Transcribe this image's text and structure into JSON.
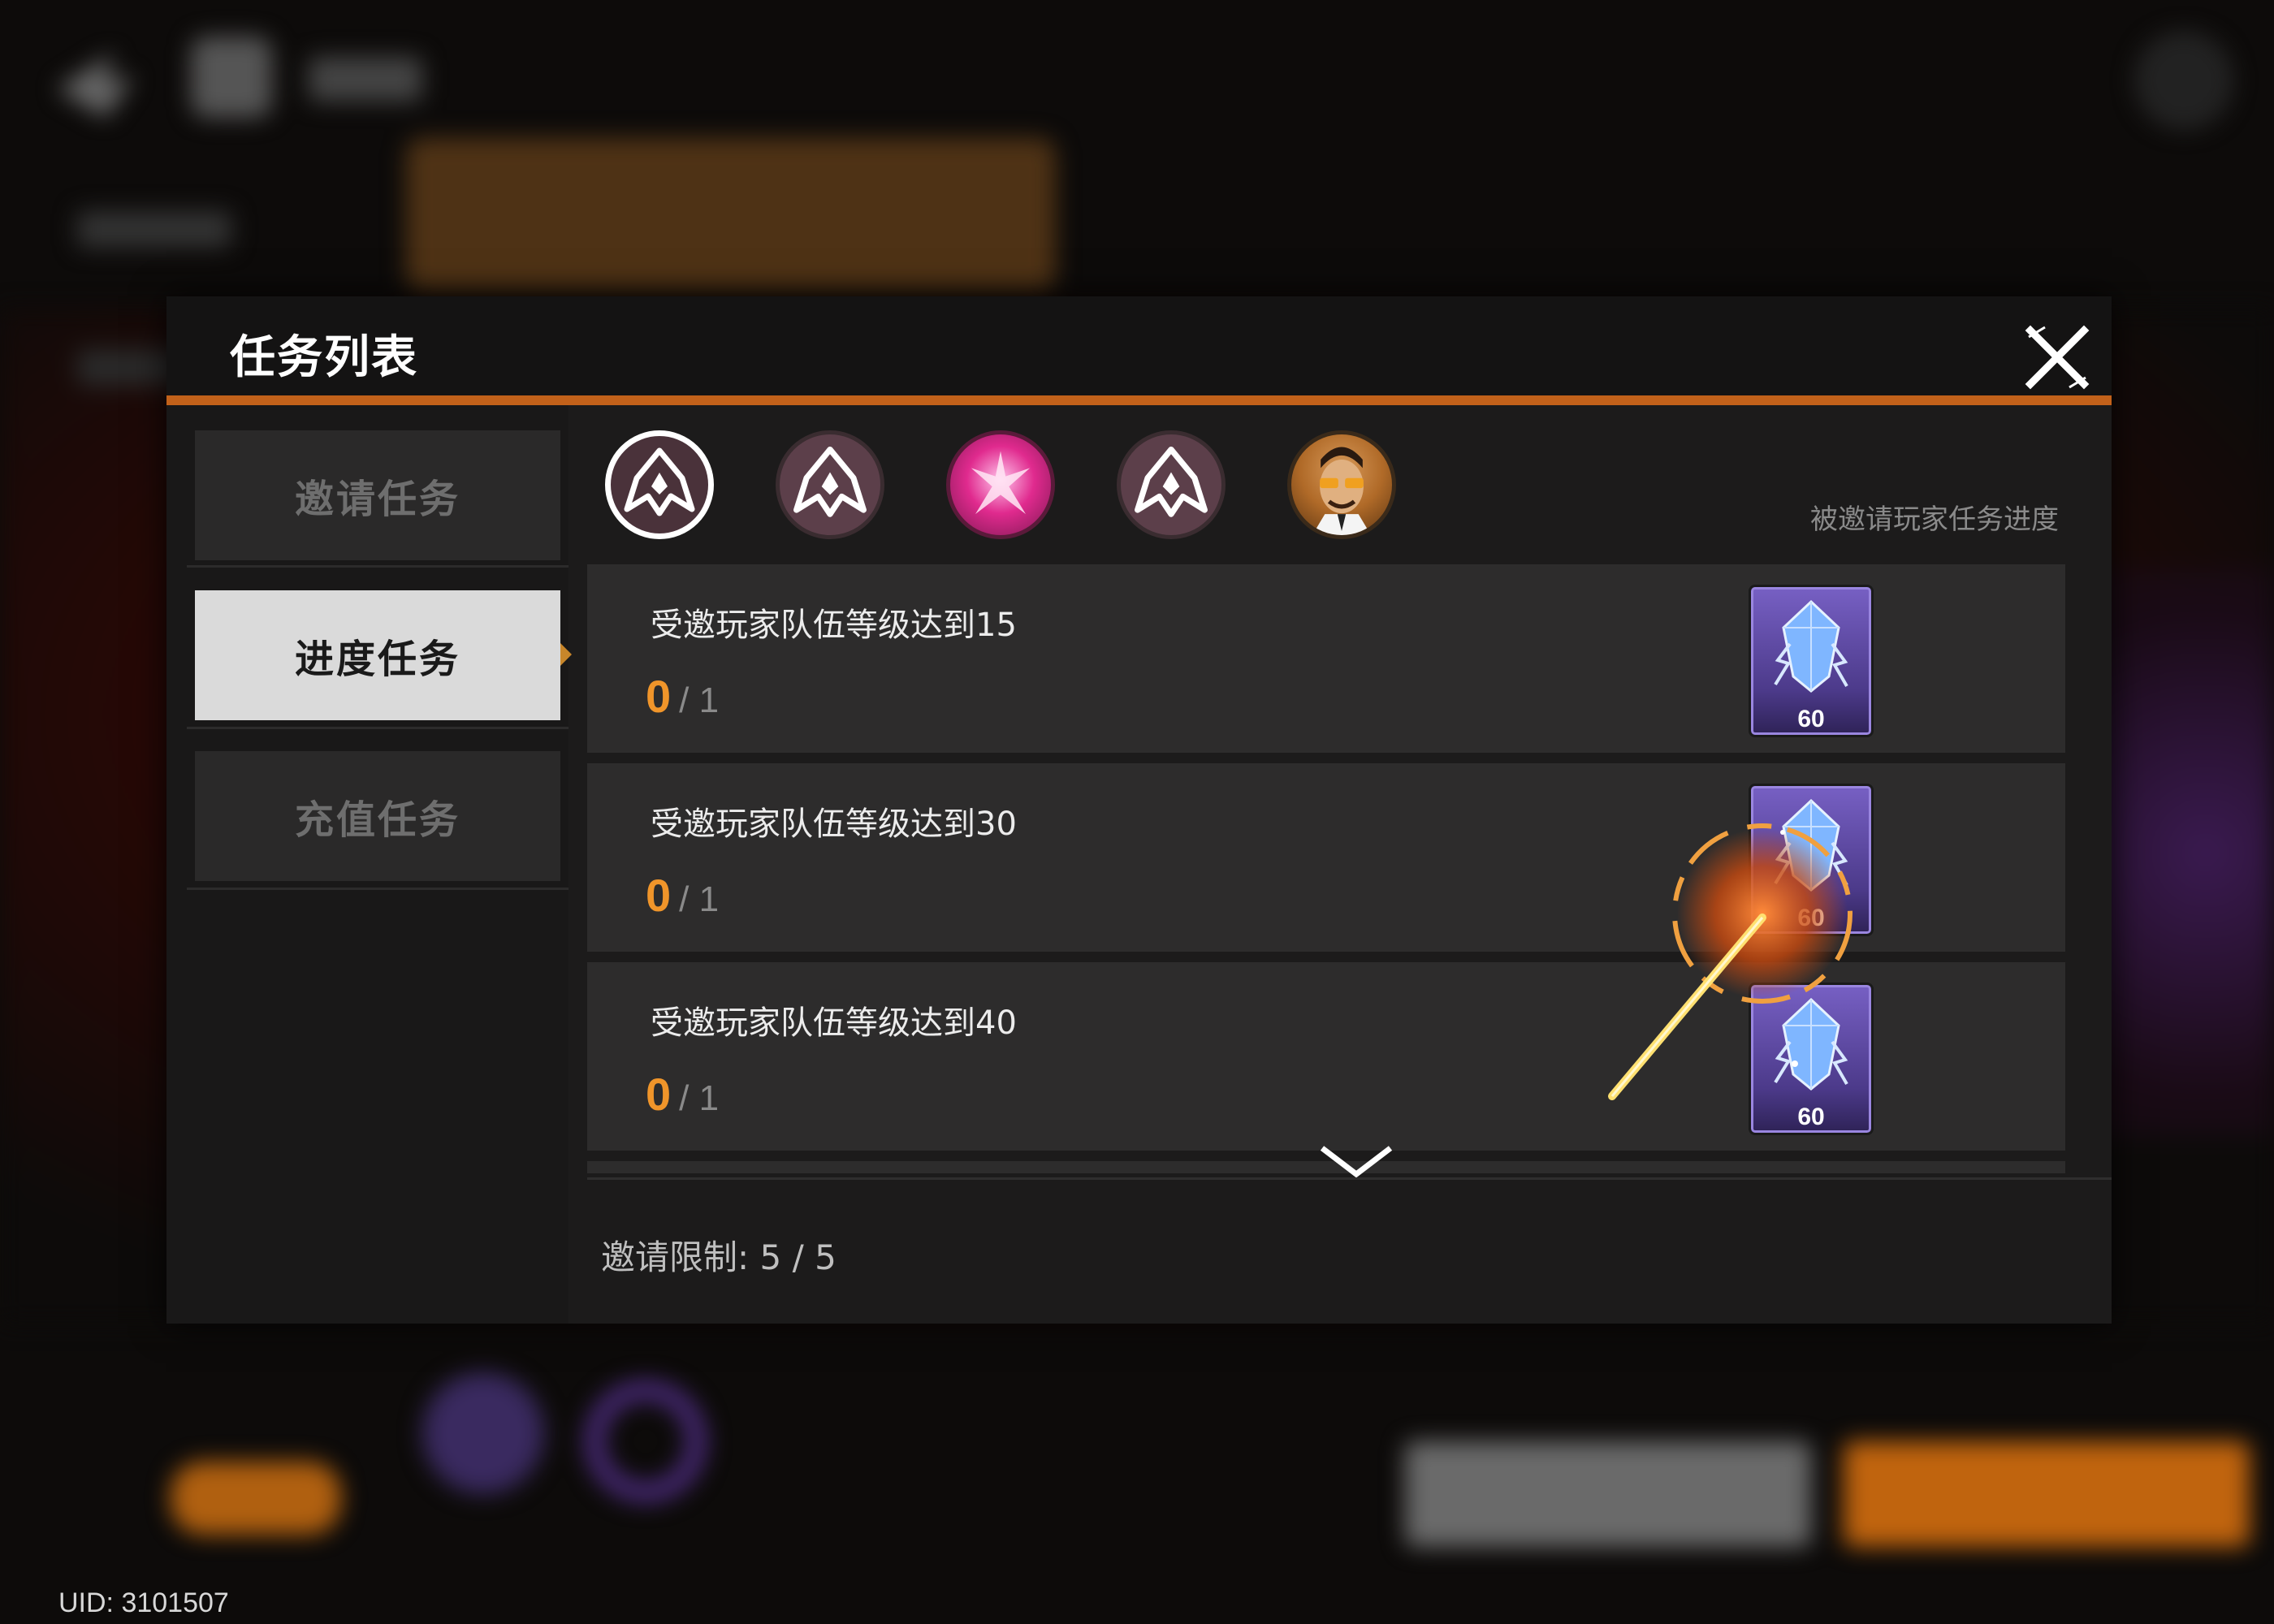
{
  "uid_label": "UID: 3101507",
  "modal": {
    "title": "任务列表",
    "close_icon": "close-icon",
    "tabs": [
      {
        "label": "邀请任务",
        "active": false
      },
      {
        "label": "进度任务",
        "active": true
      },
      {
        "label": "充值任务",
        "active": false
      }
    ],
    "avatars": [
      {
        "icon": "faction-emblem-icon",
        "selected": true
      },
      {
        "icon": "faction-emblem-icon",
        "selected": false
      },
      {
        "icon": "pink-character-portrait",
        "selected": false
      },
      {
        "icon": "faction-emblem-icon",
        "selected": false
      },
      {
        "icon": "character-portrait-sunglasses",
        "selected": false
      }
    ],
    "progress_label": "被邀请玩家任务进度",
    "tasks": [
      {
        "name": "受邀玩家队伍等级达到15",
        "progress": "0",
        "total": "/ 1",
        "reward_icon": "purple-crystal-icon",
        "reward_count": "60"
      },
      {
        "name": "受邀玩家队伍等级达到30",
        "progress": "0",
        "total": "/ 1",
        "reward_icon": "purple-crystal-icon",
        "reward_count": "60"
      },
      {
        "name": "受邀玩家队伍等级达到40",
        "progress": "0",
        "total": "/ 1",
        "reward_icon": "purple-crystal-icon",
        "reward_count": "60"
      }
    ],
    "invite_limit": "邀请限制: 5 / 5"
  },
  "colors": {
    "accent_orange": "#c2611a",
    "progress_orange": "#f0952a",
    "reward_purple": "#6a55b8"
  }
}
